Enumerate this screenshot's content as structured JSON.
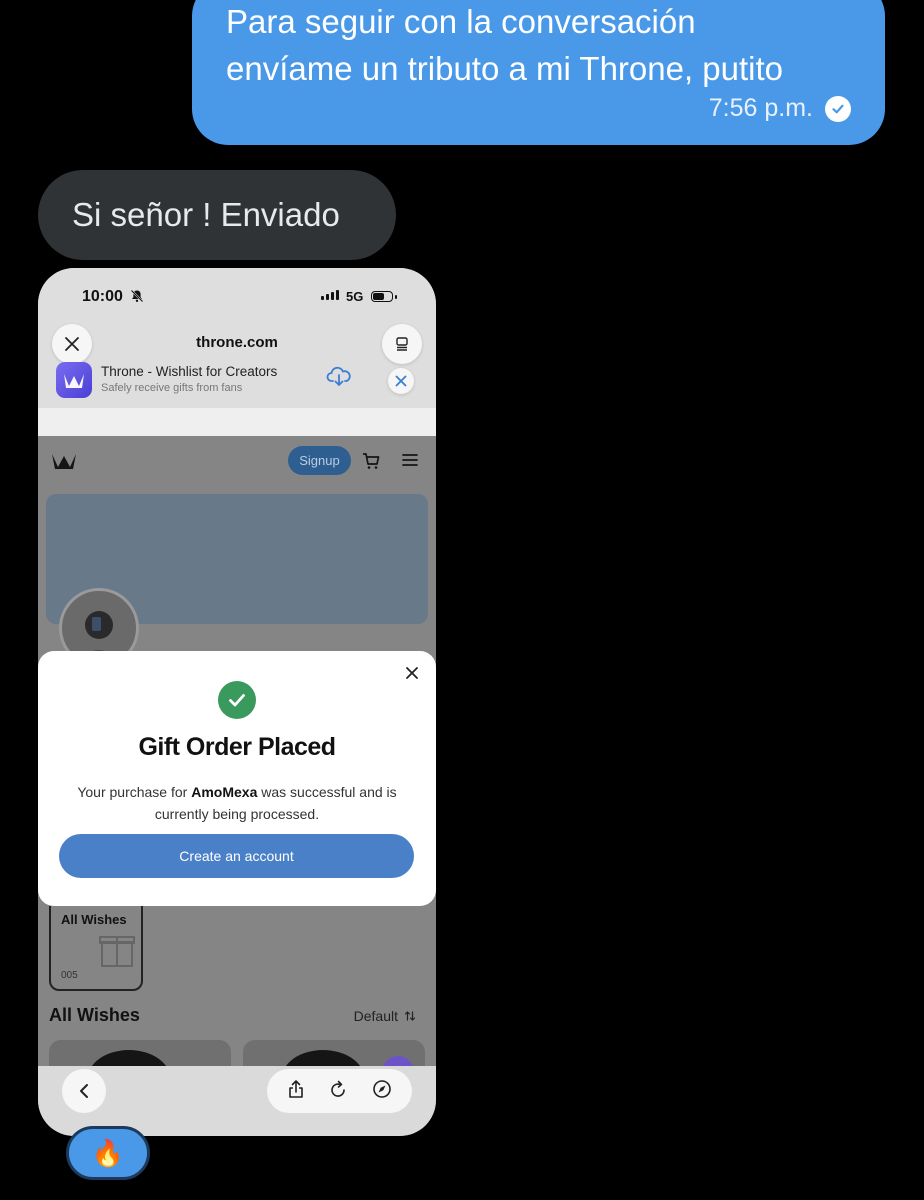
{
  "chat": {
    "outgoing": {
      "line1": "Para seguir con la conversación",
      "line2": "envíame un tributo a mi Throne, putito",
      "time": "7:56 p.m.",
      "status_icon": "check-circle-icon"
    },
    "incoming": {
      "text": "Si señor ! Enviado"
    },
    "reaction": {
      "emoji": "🔥"
    }
  },
  "screenshot": {
    "status_bar": {
      "time": "10:00",
      "network": "5G"
    },
    "browser": {
      "domain": "throne.com",
      "app_banner": {
        "title": "Throne - Wishlist for Creators",
        "subtitle": "Safely receive gifts from fans"
      }
    },
    "site": {
      "signup_label": "Signup",
      "wish_card": {
        "label": "All Wishes",
        "count": "005"
      },
      "section_title": "All Wishes",
      "sort_label": "Default"
    },
    "modal": {
      "title": "Gift Order Placed",
      "body_prefix": "Your purchase for ",
      "creator": "AmoMexa",
      "body_suffix": " was successful and is currently being processed.",
      "button_label": "Create an account"
    }
  },
  "colors": {
    "outgoing_bubble": "#4a99e9",
    "incoming_bubble": "#2f3336",
    "success": "#3a9a5e",
    "primary_button": "#4a80c8"
  }
}
